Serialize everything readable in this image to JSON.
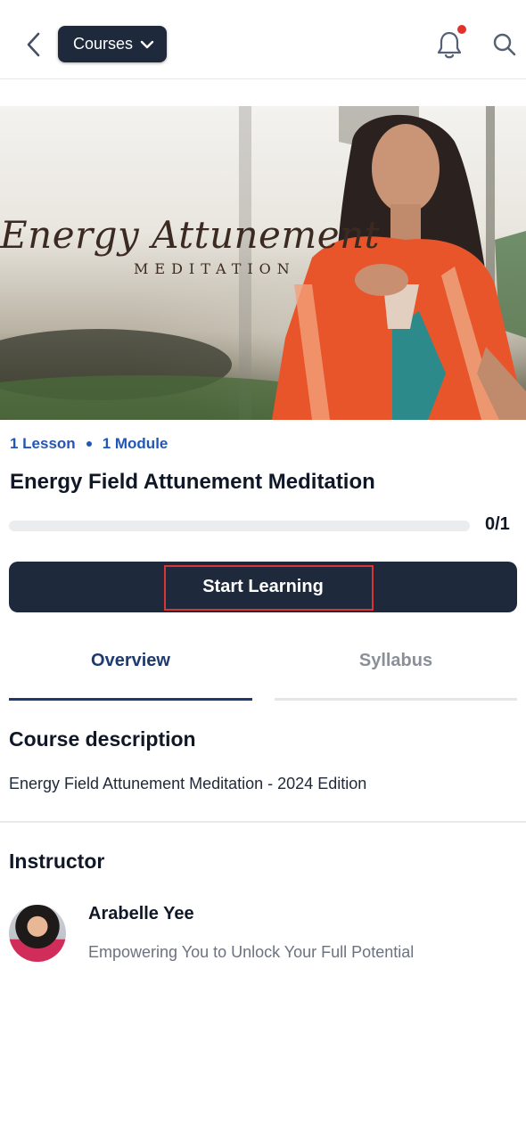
{
  "header": {
    "back_icon": "chevron-left-icon",
    "courses_label": "Courses",
    "dropdown_icon": "chevron-down-icon",
    "notification_icon": "bell-icon",
    "search_icon": "search-icon"
  },
  "hero": {
    "title": "Energy Attunement",
    "subtitle": "MEDITATION"
  },
  "course": {
    "lessons": "1 Lesson",
    "modules": "1 Module",
    "title": "Energy Field Attunement Meditation",
    "progress_text": "0/1",
    "progress_fraction": 0
  },
  "start_button": "Start Learning",
  "tabs": {
    "overview": "Overview",
    "syllabus": "Syllabus",
    "active": "Overview"
  },
  "description": {
    "heading": "Course description",
    "text": "Energy Field Attunement Meditation - 2024 Edition"
  },
  "instructor": {
    "heading": "Instructor",
    "name": "Arabelle Yee",
    "bio": "Empowering You to Unlock Your Full Potential"
  },
  "colors": {
    "primary": "#1e293b",
    "accent_blue": "#2357b5",
    "notification_dot": "#e0322c",
    "highlight": "#d93535"
  }
}
